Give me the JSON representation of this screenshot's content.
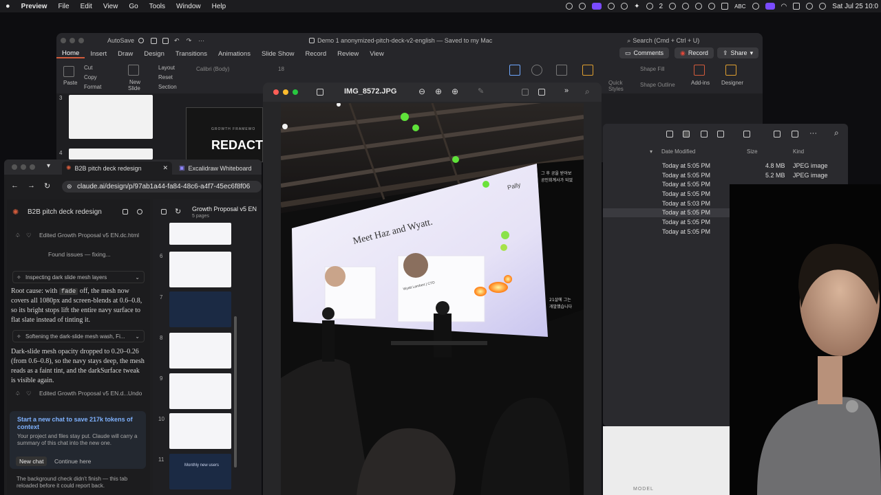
{
  "menubar": {
    "app": "Preview",
    "items": [
      "File",
      "Edit",
      "View",
      "Go",
      "Tools",
      "Window",
      "Help"
    ],
    "tray_badge": "2",
    "input_label": "ABC",
    "clock": "Sat Jul 25  10:0"
  },
  "ppt": {
    "autosave": "AutoSave",
    "doc_title": "Demo 1 anonymized-pitch-deck-v2-english — Saved to my Mac",
    "search": "Search (Cmd + Ctrl + U)",
    "tabs": [
      "Home",
      "Insert",
      "Draw",
      "Design",
      "Transitions",
      "Animations",
      "Slide Show",
      "Record",
      "Review",
      "View"
    ],
    "comments": "Comments",
    "record": "Record",
    "share": "Share",
    "ribbon": {
      "paste": "Paste",
      "cut": "Cut",
      "copy": "Copy",
      "format": "Format",
      "new_slide_1": "New",
      "new_slide_2": "Slide",
      "layout": "Layout",
      "reset": "Reset",
      "section": "Section",
      "font": "Calibri (Body)",
      "font_size": "18",
      "shape_fill": "Shape Fill",
      "shape_outline": "Shape Outline",
      "quick_styles_1": "Quick",
      "quick_styles_2": "Styles",
      "addins": "Add-ins",
      "designer": "Designer"
    },
    "slide_numbers": [
      "3",
      "4"
    ],
    "slide_kicker": "GROWTH FRAMEWO",
    "slide_heading": "REDACT"
  },
  "finder": {
    "headers": {
      "modified": "Date Modified",
      "size": "Size",
      "kind": "Kind"
    },
    "rows": [
      {
        "modified": "Today at 5:05 PM",
        "size": "4.8 MB",
        "kind": "JPEG image"
      },
      {
        "modified": "Today at 5:05 PM",
        "size": "5.2 MB",
        "kind": "JPEG image"
      },
      {
        "modified": "Today at 5:05 PM",
        "size": "",
        "kind": ""
      },
      {
        "modified": "Today at 5:05 PM",
        "size": "",
        "kind": ""
      },
      {
        "modified": "Today at 5:03 PM",
        "size": "",
        "kind": ""
      },
      {
        "modified": "Today at 5:05 PM",
        "size": "",
        "kind": ""
      },
      {
        "modified": "Today at 5:05 PM",
        "size": "",
        "kind": ""
      },
      {
        "modified": "Today at 5:05 PM",
        "size": "",
        "kind": ""
      }
    ],
    "footer_label": "MODEL"
  },
  "chrome": {
    "tabs": [
      "B2B pitch deck redesign",
      "Excalidraw Whiteboard"
    ],
    "url": "claude.ai/design/p/97ab1a44-fa84-48c6-a4f7-45ec6f8f06"
  },
  "chat": {
    "project": "B2B pitch deck redesign",
    "edited_1": "Edited Growth Proposal v5 EN.dc.html",
    "found_issues": "Found issues — fixing...",
    "step_1": "Inspecting dark slide mesh layers",
    "msg_1a": "Root cause: with",
    "msg_1_code": "fade",
    "msg_1b": "off, the mesh now covers all 1080px and screen-blends at 0.6–0.8, so its bright stops lift the entire navy surface to flat slate instead of tinting it.",
    "step_2": "Softening the dark-slide mesh wash, Fi...",
    "msg_2": "Dark-slide mesh opacity dropped to 0.20–0.26 (from 0.6–0.8), so the navy stays deep, the mesh reads as a faint tint, and the darkSurface tweak is visible again.",
    "edited_2": "Edited Growth Proposal v5 EN.d...",
    "undo": "Undo",
    "new_chat_title": "Start a new chat to save 217k tokens of context",
    "new_chat_body": "Your project and files stay put. Claude will carry a summary of this chat into the new one.",
    "new_chat_btn": "New chat",
    "continue_btn": "Continue here",
    "bg_note": "The background check didn't finish — this tab reloaded before it could report back."
  },
  "files": {
    "title": "Growth Proposal v5 EN",
    "pages": "5 pages",
    "numbers": [
      "6",
      "7",
      "8",
      "9",
      "10",
      "11"
    ],
    "thumb_11_text": "Monthly new users"
  },
  "preview": {
    "filename": "IMG_8572.JPG",
    "slide": {
      "title": "Meet Haz and Wyatt.",
      "brand": "Pally",
      "person2_caption": "Wyatt Lambert | CTO",
      "korean_1": "그 후 공을 받아보",
      "korean_2": "공인회계사가 되었",
      "korean_3": "21살에 그는",
      "korean_4": "개발했습니다"
    }
  },
  "colors": {
    "accent_red": "#d35b3b",
    "link_blue": "#6fa8ff",
    "record_red": "#e0483a"
  }
}
